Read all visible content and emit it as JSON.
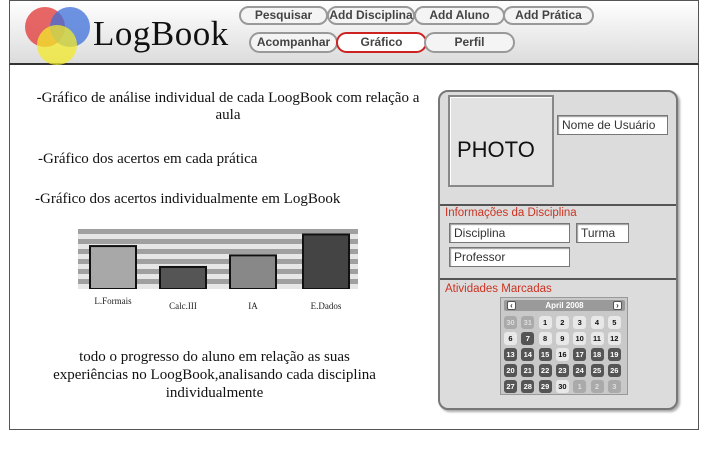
{
  "app": {
    "logo_text": "LogBook"
  },
  "nav": {
    "row1": [
      "Pesquisar",
      "Add Disciplina",
      "Add Aluno",
      "Add Prática"
    ],
    "row2": [
      "Acompanhar",
      "Gráfico",
      "Perfil"
    ],
    "active": "Gráfico"
  },
  "main": {
    "bullets": [
      "-Gráfico de análise individual de cada LoogBook com relação a aula",
      "-Gráfico dos acertos em cada prática",
      "-Gráfico dos acertos individualmente em LogBook"
    ],
    "summary": "todo o progresso do aluno em relação as suas experiências no LoogBook,analisando cada disciplina individualmente"
  },
  "chart_data": {
    "type": "bar",
    "categories": [
      "L.Formais",
      "Calc.III",
      "IA",
      "E.Dados"
    ],
    "values": [
      0.74,
      0.38,
      0.58,
      0.94
    ],
    "bar_colors": [
      "#a8a8a8",
      "#555555",
      "#888888",
      "#444444"
    ],
    "grid": true,
    "ylim": [
      0,
      1
    ]
  },
  "profile": {
    "photo_label": "PHOTO",
    "username_field": "Nome de Usuário",
    "discipline_section": "Informações da Disciplina",
    "discipline_placeholder": "Disciplina",
    "class_placeholder": "Turma",
    "teacher_placeholder": "Professor",
    "activities_section": "Atividades Marcadas"
  },
  "calendar": {
    "title": "April 2008",
    "prev_icon": "chevron-left-icon",
    "next_icon": "chevron-right-icon",
    "weeks": [
      [
        {
          "d": "30",
          "s": "out"
        },
        {
          "d": "31",
          "s": "out"
        },
        {
          "d": "1",
          "s": "hi"
        },
        {
          "d": "2",
          "s": "hi"
        },
        {
          "d": "3",
          "s": "hi"
        },
        {
          "d": "4",
          "s": "hi"
        },
        {
          "d": "5",
          "s": "hi"
        }
      ],
      [
        {
          "d": "6",
          "s": "hi"
        },
        {
          "d": "7",
          "s": "on"
        },
        {
          "d": "8",
          "s": "hi"
        },
        {
          "d": "9",
          "s": "hi"
        },
        {
          "d": "10",
          "s": "hi"
        },
        {
          "d": "11",
          "s": "hi"
        },
        {
          "d": "12",
          "s": "hi"
        }
      ],
      [
        {
          "d": "13",
          "s": "on"
        },
        {
          "d": "14",
          "s": "on"
        },
        {
          "d": "15",
          "s": "on"
        },
        {
          "d": "16",
          "s": "hi"
        },
        {
          "d": "17",
          "s": "on"
        },
        {
          "d": "18",
          "s": "on"
        },
        {
          "d": "19",
          "s": "on"
        }
      ],
      [
        {
          "d": "20",
          "s": "on"
        },
        {
          "d": "21",
          "s": "on"
        },
        {
          "d": "22",
          "s": "on"
        },
        {
          "d": "23",
          "s": "on"
        },
        {
          "d": "24",
          "s": "on"
        },
        {
          "d": "25",
          "s": "on"
        },
        {
          "d": "26",
          "s": "on"
        }
      ],
      [
        {
          "d": "27",
          "s": "on"
        },
        {
          "d": "28",
          "s": "on"
        },
        {
          "d": "29",
          "s": "on"
        },
        {
          "d": "30",
          "s": "hi"
        },
        {
          "d": "1",
          "s": "out"
        },
        {
          "d": "2",
          "s": "out"
        },
        {
          "d": "3",
          "s": "out"
        }
      ]
    ]
  }
}
